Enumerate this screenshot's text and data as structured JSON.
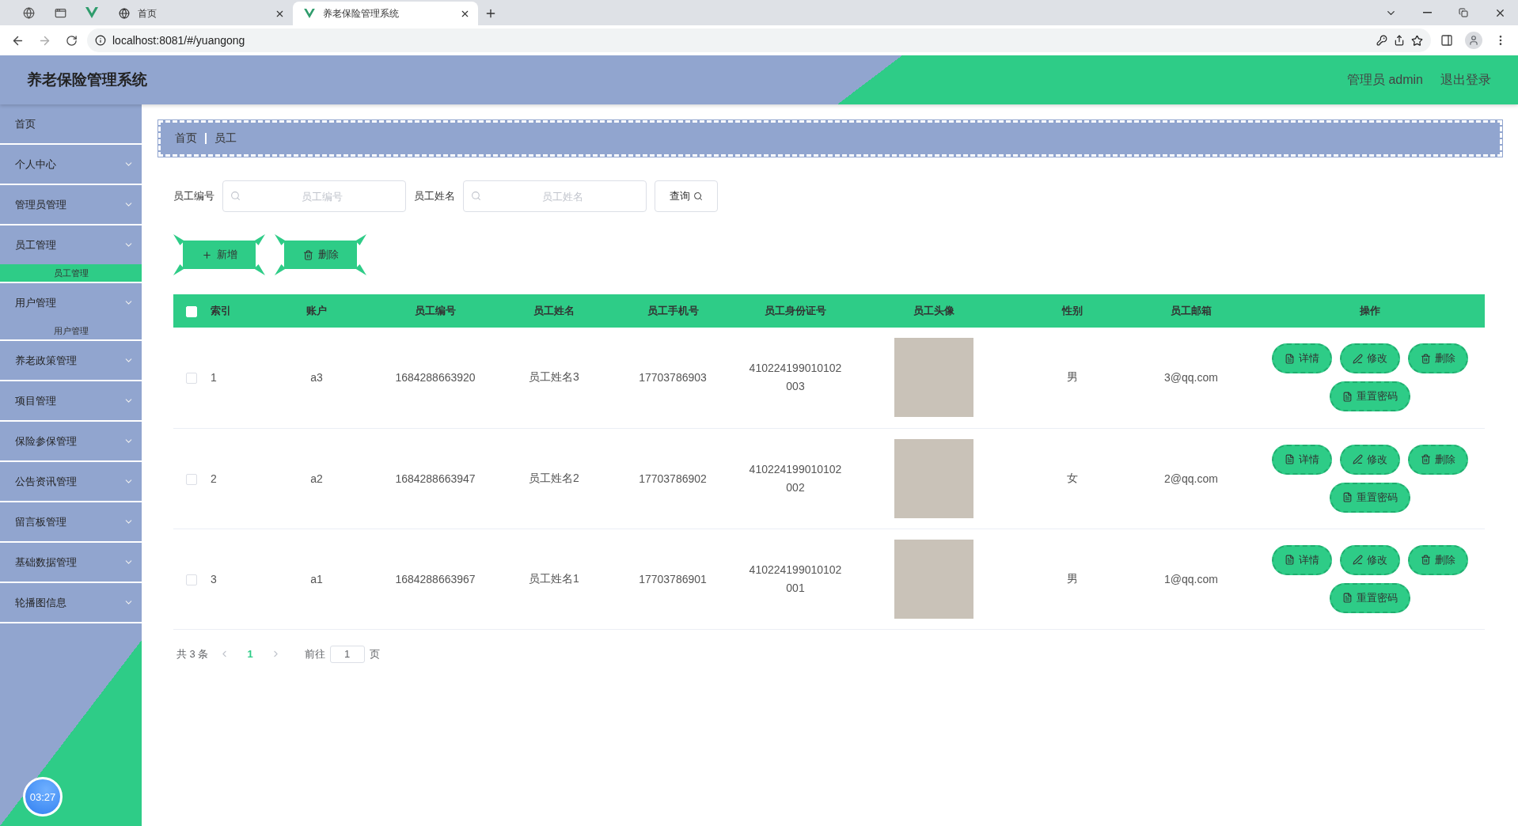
{
  "browser": {
    "tabs": [
      {
        "title": "首页",
        "selected": false
      },
      {
        "title": "养老保险管理系统",
        "selected": true
      }
    ],
    "address": "localhost:8081/#/yuangong"
  },
  "header": {
    "title": "养老保险管理系统",
    "user": "管理员 admin",
    "logout": "退出登录"
  },
  "sidebar": {
    "items": [
      {
        "label": "首页",
        "kind": "link"
      },
      {
        "label": "个人中心",
        "kind": "group"
      },
      {
        "label": "管理员管理",
        "kind": "group"
      },
      {
        "label": "员工管理",
        "kind": "group",
        "children": [
          {
            "label": "员工管理",
            "selected": true
          }
        ]
      },
      {
        "label": "用户管理",
        "kind": "group",
        "children": [
          {
            "label": "用户管理",
            "selected": false
          }
        ]
      },
      {
        "label": "养老政策管理",
        "kind": "group"
      },
      {
        "label": "项目管理",
        "kind": "group"
      },
      {
        "label": "保险参保管理",
        "kind": "group"
      },
      {
        "label": "公告资讯管理",
        "kind": "group"
      },
      {
        "label": "留言板管理",
        "kind": "group"
      },
      {
        "label": "基础数据管理",
        "kind": "group"
      },
      {
        "label": "轮播图信息",
        "kind": "group"
      }
    ]
  },
  "clock": "03:27",
  "breadcrumb": [
    "首页",
    "员工"
  ],
  "search": {
    "fields": [
      {
        "label": "员工编号",
        "placeholder": "员工编号"
      },
      {
        "label": "员工姓名",
        "placeholder": "员工姓名"
      }
    ],
    "button": "查询"
  },
  "actions": [
    {
      "label": "新增",
      "kind": "add"
    },
    {
      "label": "删除",
      "kind": "delete"
    }
  ],
  "table": {
    "all_selected": false,
    "columns": [
      "索引",
      "账户",
      "员工编号",
      "员工姓名",
      "员工手机号",
      "员工身份证号",
      "员工头像",
      "性别",
      "员工邮箱",
      "操作"
    ],
    "rows": [
      {
        "selected": false,
        "index": "1",
        "account": "a3",
        "number": "1684288663920",
        "name": "员工姓名3",
        "phone": "17703786903",
        "id_card": "410224199010102003",
        "gender": "男",
        "email": "3@qq.com",
        "actions": [
          {
            "label": "详情",
            "kind": "detail"
          },
          {
            "label": "修改",
            "kind": "edit"
          },
          {
            "label": "删除",
            "kind": "delete"
          },
          {
            "label": "重置密码",
            "kind": "reset"
          }
        ]
      },
      {
        "selected": false,
        "index": "2",
        "account": "a2",
        "number": "1684288663947",
        "name": "员工姓名2",
        "phone": "17703786902",
        "id_card": "410224199010102002",
        "gender": "女",
        "email": "2@qq.com",
        "actions": [
          {
            "label": "详情",
            "kind": "detail"
          },
          {
            "label": "修改",
            "kind": "edit"
          },
          {
            "label": "删除",
            "kind": "delete"
          },
          {
            "label": "重置密码",
            "kind": "reset"
          }
        ]
      },
      {
        "selected": false,
        "index": "3",
        "account": "a1",
        "number": "1684288663967",
        "name": "员工姓名1",
        "phone": "17703786901",
        "id_card": "410224199010102001",
        "gender": "男",
        "email": "1@qq.com",
        "actions": [
          {
            "label": "详情",
            "kind": "detail"
          },
          {
            "label": "修改",
            "kind": "edit"
          },
          {
            "label": "删除",
            "kind": "delete"
          },
          {
            "label": "重置密码",
            "kind": "reset"
          }
        ]
      }
    ]
  },
  "pagination": {
    "total": "共 3 条",
    "pages": [
      {
        "label": "1",
        "selected": true
      }
    ],
    "goto_label": "前往",
    "goto_value": "1",
    "suffix": "页"
  }
}
